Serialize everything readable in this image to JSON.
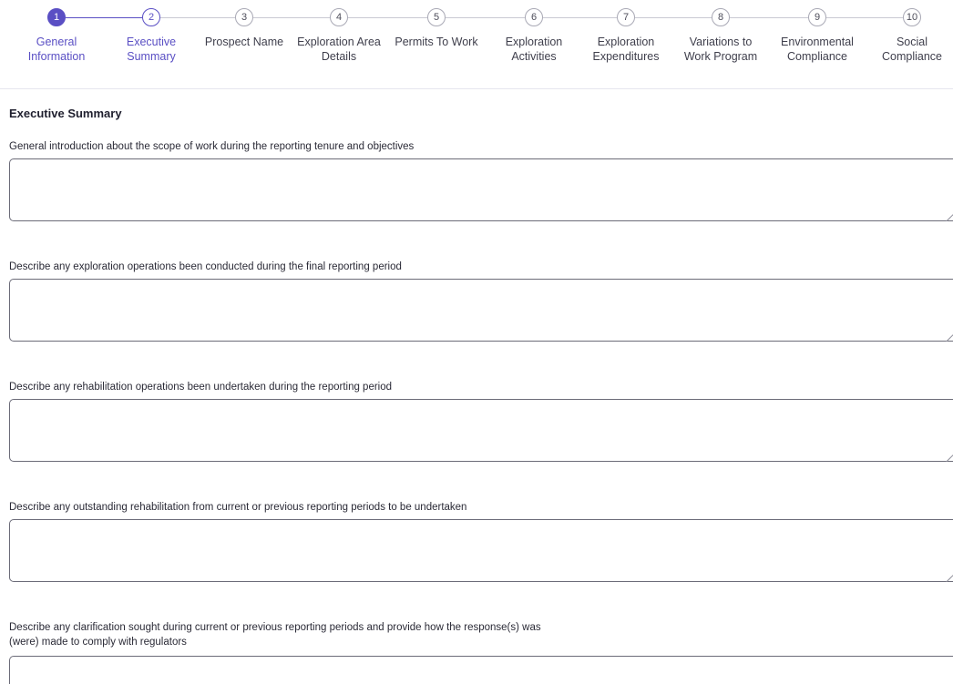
{
  "stepper": {
    "steps": [
      {
        "number": "1",
        "label": "General\nInformation",
        "state": "active"
      },
      {
        "number": "2",
        "label": "Executive\nSummary",
        "state": "current"
      },
      {
        "number": "3",
        "label": "Prospect Name",
        "state": "pending"
      },
      {
        "number": "4",
        "label": "Exploration Area\nDetails",
        "state": "pending"
      },
      {
        "number": "5",
        "label": "Permits To Work",
        "state": "pending"
      },
      {
        "number": "6",
        "label": "Exploration\nActivities",
        "state": "pending"
      },
      {
        "number": "7",
        "label": "Exploration\nExpenditures",
        "state": "pending"
      },
      {
        "number": "8",
        "label": "Variations to\nWork Program",
        "state": "pending"
      },
      {
        "number": "9",
        "label": "Environmental\nCompliance",
        "state": "pending"
      },
      {
        "number": "10",
        "label": "Social\nCompliance",
        "state": "pending"
      }
    ],
    "accent_color": "#5a4fc4"
  },
  "form": {
    "section_title": "Executive Summary",
    "fields": [
      {
        "label": "General introduction about the scope of work during the reporting tenure and objectives",
        "value": ""
      },
      {
        "label": "Describe any exploration operations been conducted during the final reporting period",
        "value": ""
      },
      {
        "label": "Describe any rehabilitation operations been undertaken during the reporting period",
        "value": ""
      },
      {
        "label": "Describe any outstanding rehabilitation from current or previous reporting periods to be undertaken",
        "value": ""
      },
      {
        "label": "Describe any clarification sought during current or previous reporting periods and provide how the response(s) was\n(were) made to comply with regulators",
        "value": ""
      }
    ]
  }
}
